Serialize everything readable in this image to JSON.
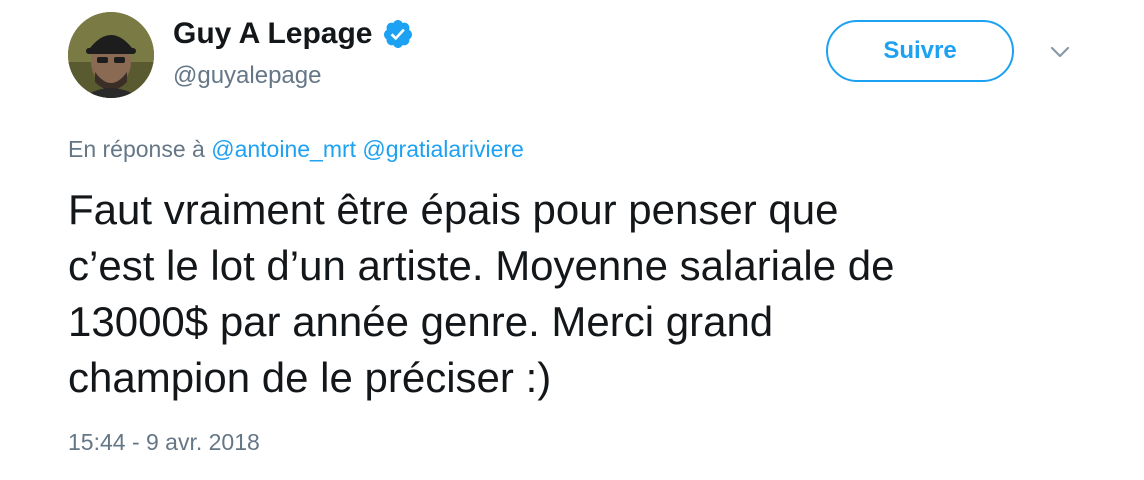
{
  "author": {
    "display_name": "Guy A Lepage",
    "handle": "@guyalepage",
    "verified": true,
    "avatar_icon": "user-avatar-photo"
  },
  "follow_button": {
    "label": "Suivre",
    "color": "#1da1f2"
  },
  "more_menu_icon": "chevron-down-icon",
  "reply_context": {
    "prefix": "En réponse à",
    "mentions": [
      "@antoine_mrt",
      "@gratialariviere"
    ]
  },
  "tweet": {
    "text": "Faut vraiment être épais pour penser que\nc’est le lot d’un artiste. Moyenne salariale de\n13000$ par année genre. Merci grand\nchampion de le préciser :)",
    "timestamp": "15:44 - 9 avr. 2018"
  },
  "colors": {
    "accent": "#1da1f2",
    "text_primary": "#14171a",
    "text_secondary": "#657786"
  }
}
